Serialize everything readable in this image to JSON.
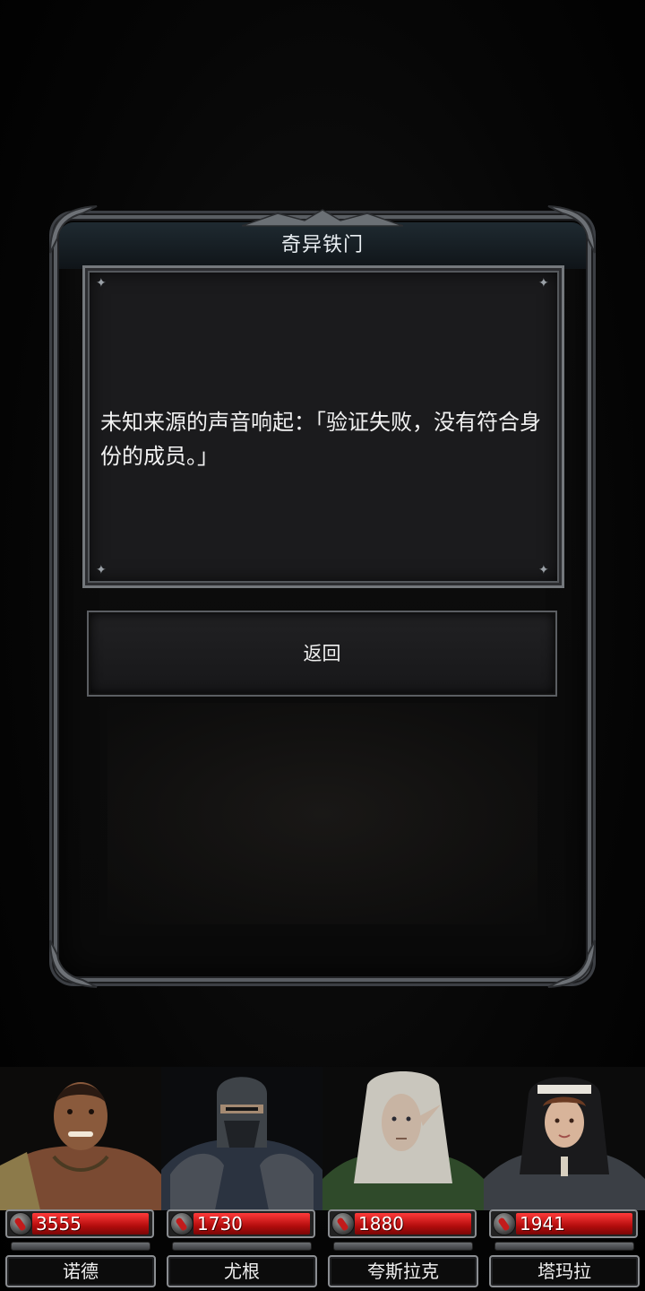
{
  "dialog": {
    "title": "奇异铁门",
    "message": "未知来源的声音响起：「验证失败，没有符合身份的成员。」",
    "back_button_label": "返回"
  },
  "party": [
    {
      "name": "诺德",
      "hp": "3555",
      "portrait": "bald-warrior-portrait"
    },
    {
      "name": "尤根",
      "hp": "1730",
      "portrait": "masked-knight-portrait"
    },
    {
      "name": "夸斯拉克",
      "hp": "1880",
      "portrait": "elf-ranger-portrait"
    },
    {
      "name": "塔玛拉",
      "hp": "1941",
      "portrait": "nun-fighter-portrait"
    }
  ],
  "colors": {
    "hp_bar": "#c91414",
    "frame": "#5a5e63",
    "title_bar": "#1f2a31"
  }
}
